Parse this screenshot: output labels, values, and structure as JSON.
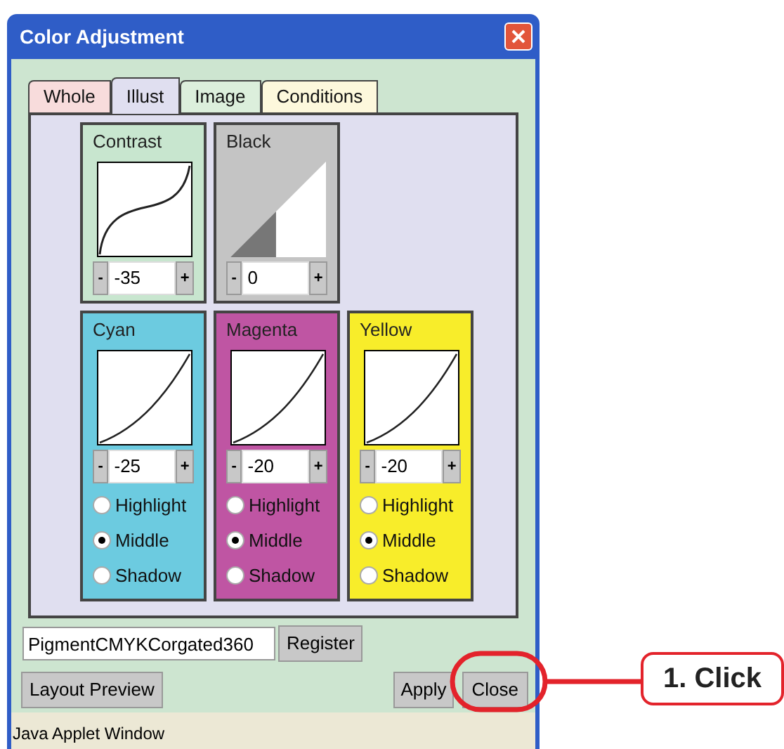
{
  "window": {
    "title": "Color Adjustment"
  },
  "tabs": [
    {
      "label": "Whole",
      "selected": false,
      "color": "#f8dcdc"
    },
    {
      "label": "Illust",
      "selected": true,
      "color": "#e0dff0"
    },
    {
      "label": "Image",
      "selected": false,
      "color": "#dcefdc"
    },
    {
      "label": "Conditions",
      "selected": false,
      "color": "#fdf8dc"
    }
  ],
  "channels": [
    {
      "name": "Contrast",
      "kind": "s-curve",
      "color": "#c8e6cf",
      "value": "-35"
    },
    {
      "name": "Black",
      "kind": "black-ramp",
      "color": "#c4c4c4",
      "value": "0"
    },
    {
      "name": "Cyan",
      "kind": "curve",
      "color": "#6ccbe0",
      "value": "-25",
      "options": [
        {
          "label": "Highlight",
          "selected": false
        },
        {
          "label": "Middle",
          "selected": true
        },
        {
          "label": "Shadow",
          "selected": false
        }
      ]
    },
    {
      "name": "Magenta",
      "kind": "curve",
      "color": "#bf55a3",
      "value": "-20",
      "options": [
        {
          "label": "Highlight",
          "selected": false
        },
        {
          "label": "Middle",
          "selected": true
        },
        {
          "label": "Shadow",
          "selected": false
        }
      ]
    },
    {
      "name": "Yellow",
      "kind": "curve",
      "color": "#f8ed2a",
      "value": "-20",
      "options": [
        {
          "label": "Highlight",
          "selected": false
        },
        {
          "label": "Middle",
          "selected": true
        },
        {
          "label": "Shadow",
          "selected": false
        }
      ]
    }
  ],
  "stepper": {
    "minus": "-",
    "plus": "+"
  },
  "profile": {
    "value": "PigmentCMYKCorgated360",
    "register": "Register"
  },
  "buttons": {
    "layout_preview": "Layout Preview",
    "apply": "Apply",
    "close": "Close"
  },
  "status_bar": "Java Applet Window",
  "callout": {
    "label": "1. Click"
  }
}
